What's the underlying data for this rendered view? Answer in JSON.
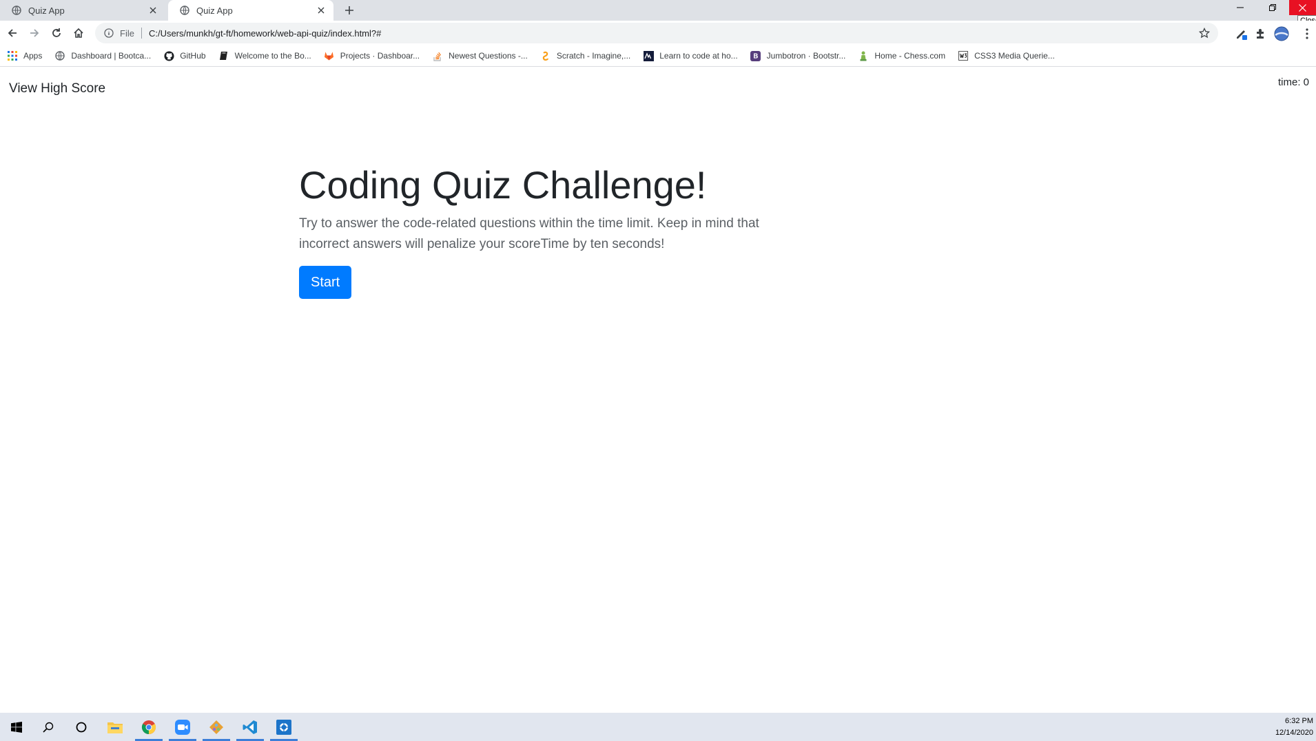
{
  "browser": {
    "tabs": [
      {
        "title": "Quiz App",
        "active": false
      },
      {
        "title": "Quiz App",
        "active": true
      }
    ],
    "close_tooltip": "Close",
    "address": {
      "scheme_label": "File",
      "url": "C:/Users/munkh/gt-ft/homework/web-api-quiz/index.html?#"
    },
    "bookmarks": [
      {
        "label": "Apps",
        "icon": "apps-grid-icon"
      },
      {
        "label": "Dashboard | Bootca...",
        "icon": "globe-icon"
      },
      {
        "label": "GitHub",
        "icon": "github-icon"
      },
      {
        "label": "Welcome to the Bo...",
        "icon": "book-icon"
      },
      {
        "label": "Projects · Dashboar...",
        "icon": "gitlab-icon"
      },
      {
        "label": "Newest Questions -...",
        "icon": "stackoverflow-icon"
      },
      {
        "label": "Scratch - Imagine,...",
        "icon": "scratch-icon"
      },
      {
        "label": "Learn to code at ho...",
        "icon": "codecademy-icon"
      },
      {
        "label": "Jumbotron · Bootstr...",
        "icon": "bootstrap-icon"
      },
      {
        "label": "Home - Chess.com",
        "icon": "chess-icon"
      },
      {
        "label": "CSS3 Media Querie...",
        "icon": "w3-icon"
      }
    ]
  },
  "page": {
    "high_score_link": "View High Score",
    "timer": "time: 0",
    "title": "Coding Quiz Challenge!",
    "description": "Try to answer the code-related questions within the time limit. Keep in mind that incorrect answers will penalize your scoreTime by ten seconds!",
    "start_label": "Start"
  },
  "taskbar": {
    "time": "6:32 PM",
    "date": "12/14/2020"
  },
  "colors": {
    "primary": "#007bff",
    "close_red": "#e81123",
    "tabstrip": "#dee1e6"
  }
}
